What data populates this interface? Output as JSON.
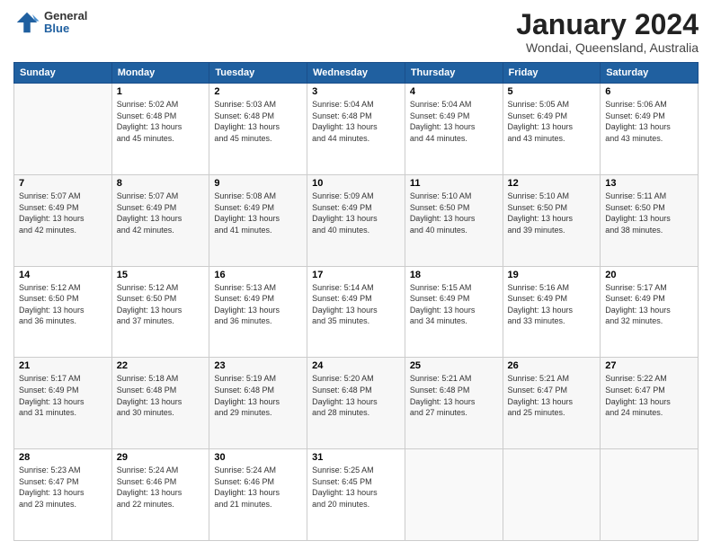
{
  "logo": {
    "general": "General",
    "blue": "Blue"
  },
  "header": {
    "month": "January 2024",
    "location": "Wondai, Queensland, Australia"
  },
  "weekdays": [
    "Sunday",
    "Monday",
    "Tuesday",
    "Wednesday",
    "Thursday",
    "Friday",
    "Saturday"
  ],
  "weeks": [
    [
      {
        "day": "",
        "info": ""
      },
      {
        "day": "1",
        "info": "Sunrise: 5:02 AM\nSunset: 6:48 PM\nDaylight: 13 hours\nand 45 minutes."
      },
      {
        "day": "2",
        "info": "Sunrise: 5:03 AM\nSunset: 6:48 PM\nDaylight: 13 hours\nand 45 minutes."
      },
      {
        "day": "3",
        "info": "Sunrise: 5:04 AM\nSunset: 6:48 PM\nDaylight: 13 hours\nand 44 minutes."
      },
      {
        "day": "4",
        "info": "Sunrise: 5:04 AM\nSunset: 6:49 PM\nDaylight: 13 hours\nand 44 minutes."
      },
      {
        "day": "5",
        "info": "Sunrise: 5:05 AM\nSunset: 6:49 PM\nDaylight: 13 hours\nand 43 minutes."
      },
      {
        "day": "6",
        "info": "Sunrise: 5:06 AM\nSunset: 6:49 PM\nDaylight: 13 hours\nand 43 minutes."
      }
    ],
    [
      {
        "day": "7",
        "info": ""
      },
      {
        "day": "8",
        "info": "Sunrise: 5:07 AM\nSunset: 6:49 PM\nDaylight: 13 hours\nand 42 minutes."
      },
      {
        "day": "9",
        "info": "Sunrise: 5:08 AM\nSunset: 6:49 PM\nDaylight: 13 hours\nand 41 minutes."
      },
      {
        "day": "10",
        "info": "Sunrise: 5:09 AM\nSunset: 6:49 PM\nDaylight: 13 hours\nand 40 minutes."
      },
      {
        "day": "11",
        "info": "Sunrise: 5:10 AM\nSunset: 6:50 PM\nDaylight: 13 hours\nand 40 minutes."
      },
      {
        "day": "12",
        "info": "Sunrise: 5:10 AM\nSunset: 6:50 PM\nDaylight: 13 hours\nand 39 minutes."
      },
      {
        "day": "13",
        "info": "Sunrise: 5:11 AM\nSunset: 6:50 PM\nDaylight: 13 hours\nand 38 minutes."
      }
    ],
    [
      {
        "day": "14",
        "info": ""
      },
      {
        "day": "15",
        "info": "Sunrise: 5:12 AM\nSunset: 6:50 PM\nDaylight: 13 hours\nand 37 minutes."
      },
      {
        "day": "16",
        "info": "Sunrise: 5:13 AM\nSunset: 6:49 PM\nDaylight: 13 hours\nand 36 minutes."
      },
      {
        "day": "17",
        "info": "Sunrise: 5:14 AM\nSunset: 6:49 PM\nDaylight: 13 hours\nand 35 minutes."
      },
      {
        "day": "18",
        "info": "Sunrise: 5:15 AM\nSunset: 6:49 PM\nDaylight: 13 hours\nand 34 minutes."
      },
      {
        "day": "19",
        "info": "Sunrise: 5:16 AM\nSunset: 6:49 PM\nDaylight: 13 hours\nand 33 minutes."
      },
      {
        "day": "20",
        "info": "Sunrise: 5:17 AM\nSunset: 6:49 PM\nDaylight: 13 hours\nand 32 minutes."
      }
    ],
    [
      {
        "day": "21",
        "info": ""
      },
      {
        "day": "22",
        "info": "Sunrise: 5:18 AM\nSunset: 6:48 PM\nDaylight: 13 hours\nand 30 minutes."
      },
      {
        "day": "23",
        "info": "Sunrise: 5:19 AM\nSunset: 6:48 PM\nDaylight: 13 hours\nand 29 minutes."
      },
      {
        "day": "24",
        "info": "Sunrise: 5:20 AM\nSunset: 6:48 PM\nDaylight: 13 hours\nand 28 minutes."
      },
      {
        "day": "25",
        "info": "Sunrise: 5:21 AM\nSunset: 6:48 PM\nDaylight: 13 hours\nand 27 minutes."
      },
      {
        "day": "26",
        "info": "Sunrise: 5:21 AM\nSunset: 6:47 PM\nDaylight: 13 hours\nand 25 minutes."
      },
      {
        "day": "27",
        "info": "Sunrise: 5:22 AM\nSunset: 6:47 PM\nDaylight: 13 hours\nand 24 minutes."
      }
    ],
    [
      {
        "day": "28",
        "info": "Sunrise: 5:23 AM\nSunset: 6:47 PM\nDaylight: 13 hours\nand 23 minutes."
      },
      {
        "day": "29",
        "info": "Sunrise: 5:24 AM\nSunset: 6:46 PM\nDaylight: 13 hours\nand 22 minutes."
      },
      {
        "day": "30",
        "info": "Sunrise: 5:24 AM\nSunset: 6:46 PM\nDaylight: 13 hours\nand 21 minutes."
      },
      {
        "day": "31",
        "info": "Sunrise: 5:25 AM\nSunset: 6:45 PM\nDaylight: 13 hours\nand 20 minutes."
      },
      {
        "day": "",
        "info": ""
      },
      {
        "day": "",
        "info": ""
      },
      {
        "day": "",
        "info": ""
      }
    ]
  ],
  "week7_day7_info": "Sunrise: 5:07 AM\nSunset: 6:49 PM\nDaylight: 13 hours\nand 42 minutes.",
  "week3_day14_info": "Sunrise: 5:12 AM\nSunset: 6:50 PM\nDaylight: 13 hours\nand 36 minutes.",
  "week4_day21_info": "Sunrise: 5:17 AM\nSunset: 6:49 PM\nDaylight: 13 hours\nand 31 minutes."
}
